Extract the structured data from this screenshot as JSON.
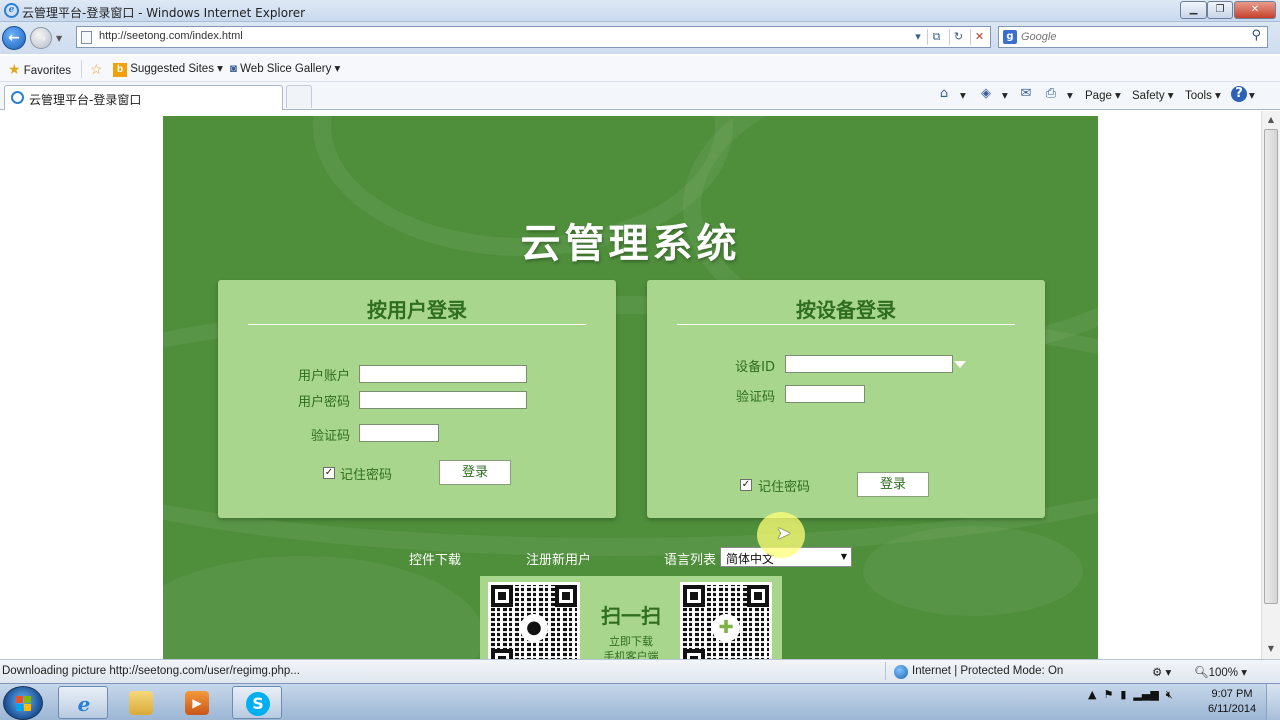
{
  "window": {
    "title": "云管理平台-登录窗口 - Windows Internet Explorer",
    "minimize": "▁",
    "restore": "❐",
    "close": "✕"
  },
  "nav": {
    "url": "http://seetong.com/index.html",
    "search_placeholder": "Google"
  },
  "favorites": {
    "favorites_label": "Favorites",
    "suggested_sites": "Suggested Sites",
    "web_slice_gallery": "Web Slice Gallery"
  },
  "tabs": {
    "active_tab": "云管理平台-登录窗口"
  },
  "commands": {
    "page": "Page",
    "safety": "Safety",
    "tools": "Tools"
  },
  "page": {
    "system_title": "云管理系统",
    "user_login": {
      "title": "按用户登录",
      "account_label": "用户账户",
      "password_label": "用户密码",
      "captcha_label": "验证码",
      "remember_label": "记住密码",
      "remember_checked": true,
      "login_button": "登录"
    },
    "device_login": {
      "title": "按设备登录",
      "device_id_label": "设备ID",
      "captcha_label": "验证码",
      "remember_label": "记住密码",
      "remember_checked": true,
      "login_button": "登录"
    },
    "links": {
      "plugin_download": "控件下载",
      "register": "注册新用户",
      "language_label": "语言列表",
      "language_value": "简体中文"
    },
    "qr": {
      "scan_title": "扫一扫",
      "line1": "立即下载",
      "line2": "手机客户端"
    }
  },
  "status": {
    "text": "Downloading picture http://seetong.com/user/regimg.php...",
    "zone": "Internet | Protected Mode: On",
    "zoom": "100%"
  },
  "taskbar": {
    "time": "9:07 PM",
    "date": "6/11/2014"
  },
  "colors": {
    "stage_green": "#4f8f3b",
    "panel_green": "#a7d68c",
    "text_green": "#2f6e21"
  }
}
